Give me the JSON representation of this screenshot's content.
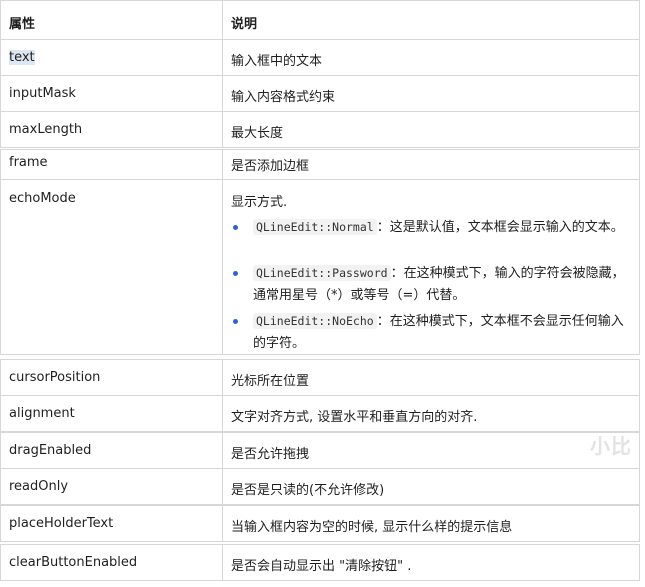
{
  "header": {
    "col1": "属性",
    "col2": "说明"
  },
  "rows": [
    {
      "prop": "text",
      "desc": "输入框中的文本"
    },
    {
      "prop": "inputMask",
      "desc": "输入内容格式约束"
    },
    {
      "prop": "maxLength",
      "desc": "最大长度"
    },
    {
      "prop": "frame",
      "desc": "是否添加边框"
    },
    {
      "prop": "echoMode",
      "desc": "显示方式.",
      "items": [
        {
          "code": "QLineEdit::Normal",
          "line1": "：这是默认值，文本框会显示输入的文本。",
          "line2": ""
        },
        {
          "code": "QLineEdit::Password",
          "line1": "：在这种模式下，输入的字符会被隐藏，",
          "line2": "通常用星号（*）或等号（=）代替。"
        },
        {
          "code": "QLineEdit::NoEcho",
          "line1": "：在这种模式下，文本框不会显示任何输入",
          "line2": "的字符。"
        }
      ]
    },
    {
      "prop": "cursorPosition",
      "desc": "光标所在位置"
    },
    {
      "prop": "alignment",
      "desc": "文字对齐方式, 设置水平和垂直方向的对齐."
    },
    {
      "prop": "dragEnabled",
      "desc": "是否允许拖拽"
    },
    {
      "prop": "readOnly",
      "desc": "是否是只读的(不允许修改)"
    },
    {
      "prop": "placeHolderText",
      "desc": "当输入框内容为空的时候, 显示什么样的提示信息"
    },
    {
      "prop": "clearButtonEnabled",
      "desc": "是否会自动显示出 \"清除按钮\" ."
    }
  ],
  "watermark": "小比"
}
